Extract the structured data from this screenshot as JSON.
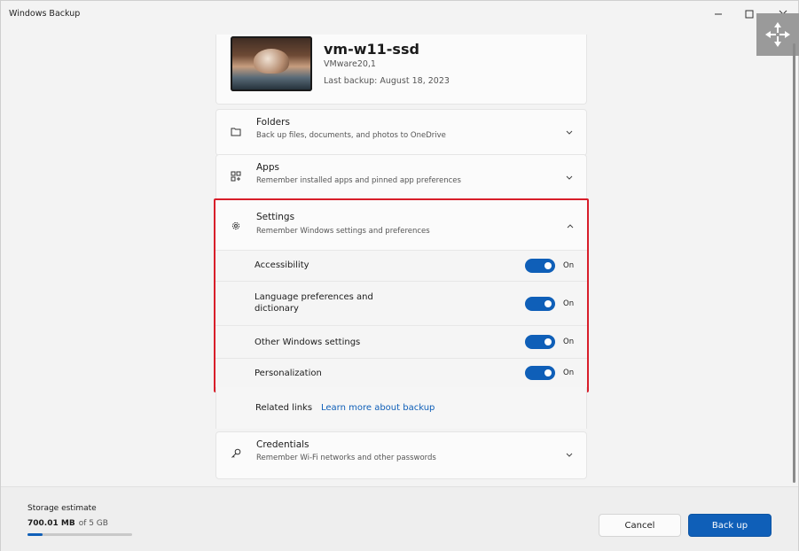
{
  "window": {
    "title": "Windows Backup",
    "controls": [
      "minimize-icon",
      "maximize-icon",
      "close-icon",
      "move-icon"
    ]
  },
  "device": {
    "name": "vm-w11-ssd",
    "model": "VMware20,1",
    "last_backup": "Last backup: August 18, 2023"
  },
  "sections": {
    "folders": {
      "title": "Folders",
      "desc": "Back up files, documents, and photos to OneDrive",
      "icon": "folder-icon",
      "expanded": false
    },
    "apps": {
      "title": "Apps",
      "desc": "Remember installed apps and pinned app preferences",
      "icon": "apps-grid-icon",
      "expanded": false
    },
    "settings": {
      "title": "Settings",
      "desc": "Remember Windows settings and preferences",
      "icon": "gear-icon",
      "expanded": true,
      "items": [
        {
          "label": "Accessibility",
          "state": "On",
          "on": true
        },
        {
          "label": "Language preferences and dictionary",
          "state": "On",
          "on": true
        },
        {
          "label": "Other Windows settings",
          "state": "On",
          "on": true
        },
        {
          "label": "Personalization",
          "state": "On",
          "on": true
        }
      ]
    },
    "credentials": {
      "title": "Credentials",
      "desc": "Remember Wi-Fi networks and other passwords",
      "icon": "key-icon",
      "expanded": false
    }
  },
  "related": {
    "label": "Related links",
    "link": "Learn more about backup"
  },
  "footer": {
    "storage_title": "Storage estimate",
    "storage_used": "700.01 MB",
    "storage_total": "of 5 GB",
    "storage_fraction": 0.14,
    "cancel_label": "Cancel",
    "backup_label": "Back up"
  },
  "colors": {
    "accent": "#0f5fb8",
    "highlight_border": "#d81e2a"
  }
}
